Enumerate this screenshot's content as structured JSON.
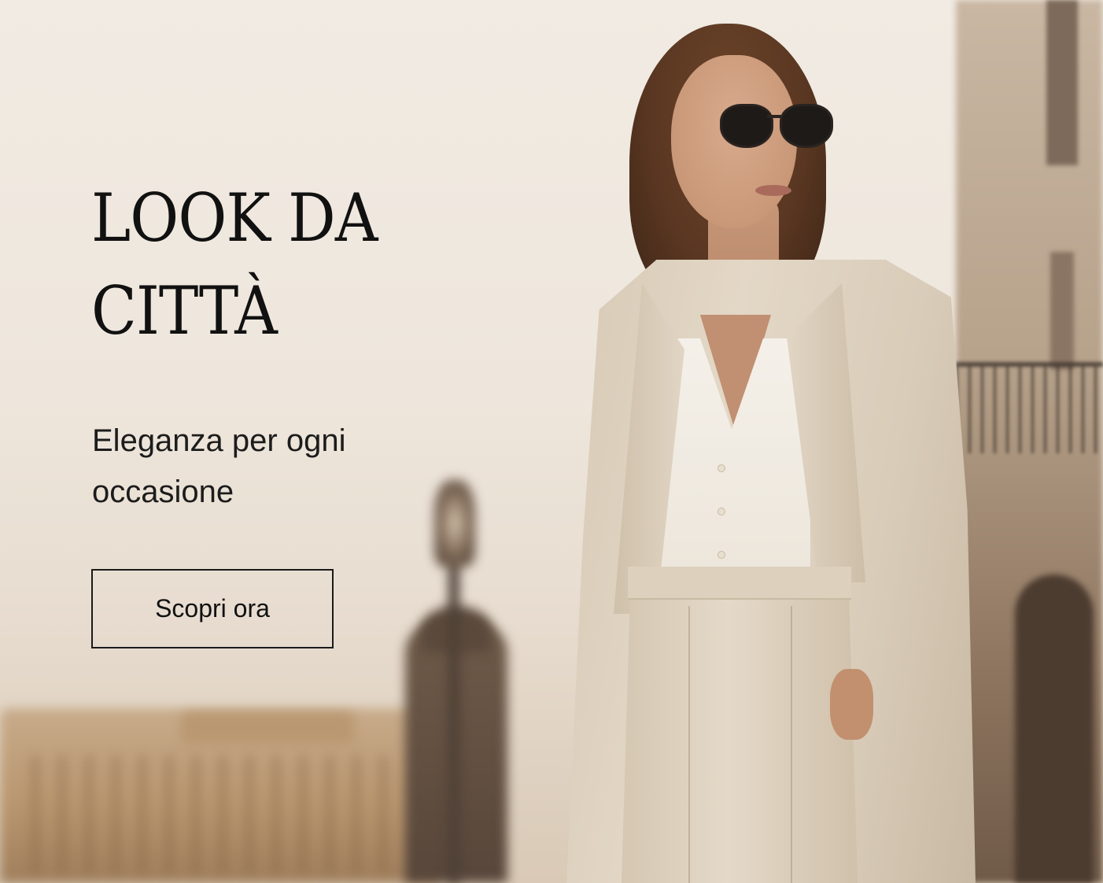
{
  "hero": {
    "headline_line1": "LOOK DA",
    "headline_line2": "CITTÀ",
    "subheadline_line1": "Eleganza per ogni",
    "subheadline_line2": "occasione",
    "cta_label": "Scopri ora"
  },
  "colors": {
    "background": "#efe7dd",
    "text": "#111111",
    "cta_border": "#1a1a1a",
    "suit": "#e3d7c6"
  }
}
